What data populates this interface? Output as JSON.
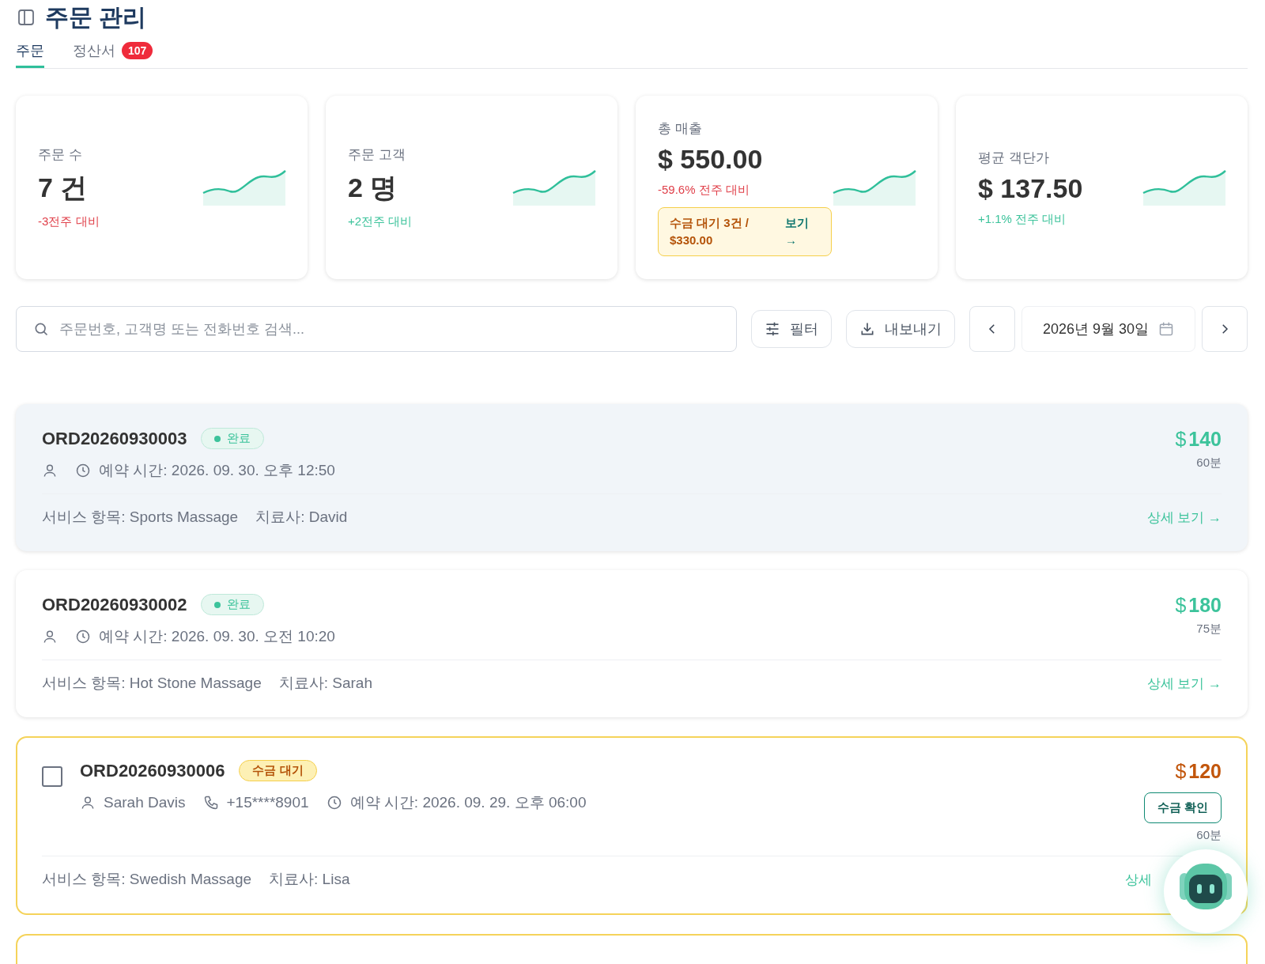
{
  "header": {
    "title": "주문 관리"
  },
  "tabs": [
    {
      "label": "주문",
      "selected": true
    },
    {
      "label": "정산서",
      "selected": false,
      "badge": "107"
    }
  ],
  "stats": [
    {
      "label": "주문 수",
      "value": "7 건",
      "delta": "-3전주 대비",
      "color": "#e0404a"
    },
    {
      "label": "주문 고객",
      "value": "2 명",
      "delta": "+2전주 대비",
      "color": "#3cc39b"
    },
    {
      "label": "총 매출",
      "value": "$ 550.00",
      "delta": "-59.6% 전주 대비",
      "color": "#e0404a",
      "alert": {
        "text": "수금 대기 3건 / $330.00",
        "link": "보기 →"
      }
    },
    {
      "label": "평균 객단가",
      "value": "$ 137.50",
      "delta": "+1.1% 전주 대비",
      "color": "#3cc39b"
    }
  ],
  "toolbar": {
    "search": {
      "placeholder": "주문번호, 고객명 또는 전화번호 검색..."
    },
    "filter": "필터",
    "export": "내보내기",
    "date": "2026년 9월 30일"
  },
  "orders": [
    {
      "kind": "done",
      "highlighted": true,
      "id": "ORD20260930003",
      "status": "완료",
      "time": "예약 시간: 2026. 09. 30. 오후 12:50",
      "service": "서비스 항목: Sports Massage",
      "therapist": "치료사: David",
      "currency": "$",
      "amount": "140",
      "duration": "60분",
      "link": "상세 보기 →"
    },
    {
      "kind": "done",
      "highlighted": false,
      "id": "ORD20260930002",
      "status": "완료",
      "time": "예약 시간: 2026. 09. 30. 오전 10:20",
      "service": "서비스 항목: Hot Stone Massage",
      "therapist": "치료사: Sarah",
      "currency": "$",
      "amount": "180",
      "duration": "75분",
      "link": "상세 보기 →"
    },
    {
      "kind": "pending",
      "highlighted": false,
      "checked": false,
      "id": "ORD20260930006",
      "status": "수금 대기",
      "customer": "Sarah Davis",
      "phone": "+15****8901",
      "time": "예약 시간: 2026. 09. 29. 오후 06:00",
      "action": "수금 확인",
      "service": "서비스 항목: Swedish Massage",
      "therapist": "치료사: Lisa",
      "currency": "$",
      "amount": "120",
      "duration": "60분",
      "link": "상세"
    },
    {
      "kind": "pending",
      "highlighted": false
    }
  ]
}
